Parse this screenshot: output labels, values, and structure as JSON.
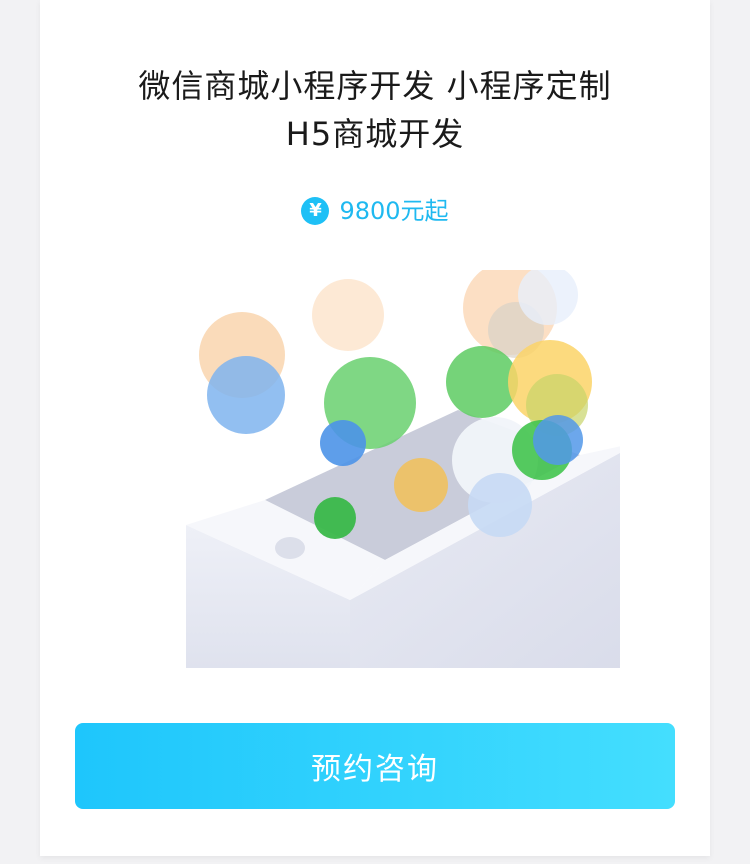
{
  "product": {
    "title_line1": "微信商城小程序开发 小程序定制",
    "title_line2": "H5商城开发",
    "price_symbol": "¥",
    "price_text": "9800元起"
  },
  "illustration": {
    "icon": "phone-with-floating-bubbles-illustration"
  },
  "cta": {
    "label": "预约咨询"
  },
  "colors": {
    "accent": "#1ec6fc",
    "accent_end": "#44defe",
    "title": "#1a1a1a"
  }
}
